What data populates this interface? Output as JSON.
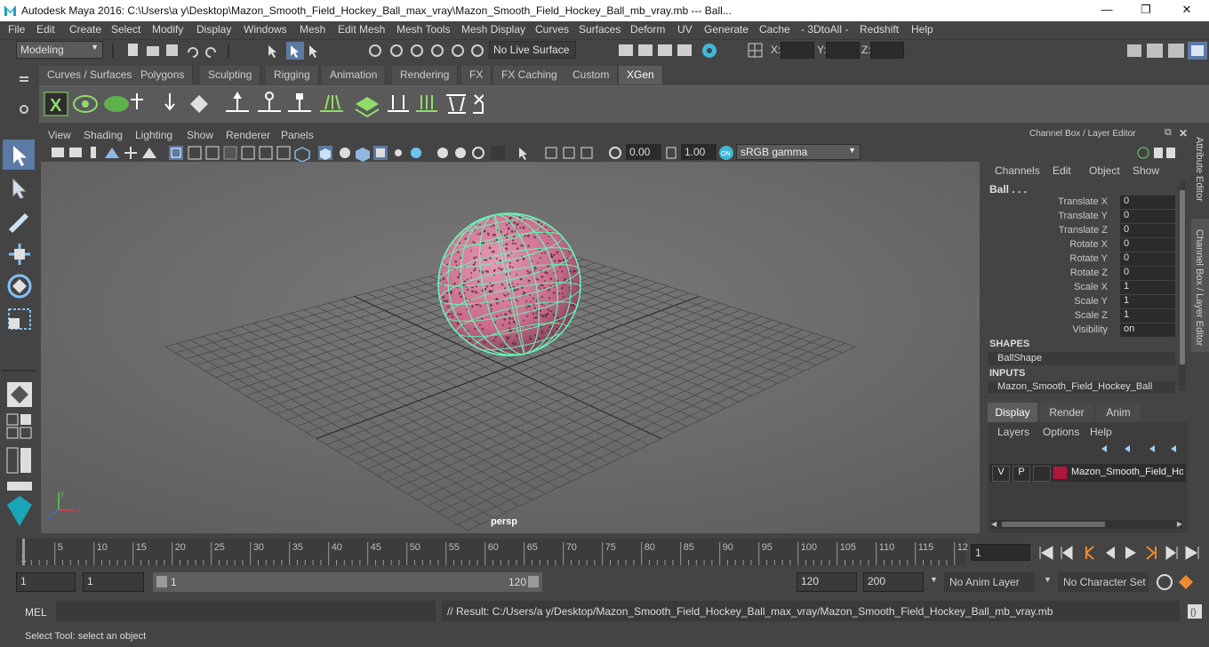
{
  "window": {
    "title": "Autodesk Maya 2016: C:\\Users\\a y\\Desktop\\Mazon_Smooth_Field_Hockey_Ball_max_vray\\Mazon_Smooth_Field_Hockey_Ball_mb_vray.mb   ---   Ball...",
    "minimize": "—",
    "maximize": "❐",
    "close": "✕"
  },
  "menu": [
    "File",
    "Edit",
    "Create",
    "Select",
    "Modify",
    "Display",
    "Windows",
    "Mesh",
    "Edit Mesh",
    "Mesh Tools",
    "Mesh Display",
    "Curves",
    "Surfaces",
    "Deform",
    "UV",
    "Generate",
    "Cache",
    "- 3DtoAll -",
    "Redshift",
    "Help"
  ],
  "status": {
    "mode": "Modeling",
    "live_surface": "No Live Surface",
    "x_label": "X:",
    "y_label": "Y:",
    "z_label": "Z:"
  },
  "shelf_tabs": [
    "Curves / Surfaces",
    "Polygons",
    "Sculpting",
    "Rigging",
    "Animation",
    "Rendering",
    "FX",
    "FX Caching",
    "Custom",
    "XGen"
  ],
  "shelf_active": "XGen",
  "viewport": {
    "menus": [
      "View",
      "Shading",
      "Lighting",
      "Show",
      "Renderer",
      "Panels"
    ],
    "exposure": "0.00",
    "gamma": "1.00",
    "colorspace": "sRGB gamma",
    "camera_label": "persp",
    "ball_color": "#c86b8c",
    "wire_color": "#5dffb5"
  },
  "channel_box": {
    "title": "Channel Box / Layer Editor",
    "menus": [
      "Channels",
      "Edit",
      "Object",
      "Show"
    ],
    "object": "Ball . . .",
    "channels": [
      {
        "label": "Translate X",
        "value": "0"
      },
      {
        "label": "Translate Y",
        "value": "0"
      },
      {
        "label": "Translate Z",
        "value": "0"
      },
      {
        "label": "Rotate X",
        "value": "0"
      },
      {
        "label": "Rotate Y",
        "value": "0"
      },
      {
        "label": "Rotate Z",
        "value": "0"
      },
      {
        "label": "Scale X",
        "value": "1"
      },
      {
        "label": "Scale Y",
        "value": "1"
      },
      {
        "label": "Scale Z",
        "value": "1"
      },
      {
        "label": "Visibility",
        "value": "on"
      }
    ],
    "shapes_header": "SHAPES",
    "shape": "BallShape",
    "inputs_header": "INPUTS",
    "input": "Mazon_Smooth_Field_Hockey_Ball"
  },
  "side_tabs": {
    "attribute_editor": "Attribute Editor",
    "channel_box": "Channel Box / Layer Editor"
  },
  "layer_editor": {
    "tabs": [
      "Display",
      "Render",
      "Anim"
    ],
    "active_tab": "Display",
    "menus": [
      "Layers",
      "Options",
      "Help"
    ],
    "layer": {
      "v": "V",
      "p": "P",
      "name": "Mazon_Smooth_Field_Hockey_Ball",
      "color": "#b0173c"
    }
  },
  "timeline": {
    "ticks": [
      "1",
      "5",
      "10",
      "15",
      "20",
      "25",
      "30",
      "35",
      "40",
      "45",
      "50",
      "55",
      "60",
      "65",
      "70",
      "75",
      "80",
      "85",
      "90",
      "95",
      "100",
      "105",
      "110",
      "115",
      "12"
    ],
    "current_frame": "1"
  },
  "range": {
    "start": "1",
    "playback_start": "1",
    "slider_start": "1",
    "slider_end": "120",
    "playback_end": "120",
    "end": "200",
    "anim_layer": "No Anim Layer",
    "character_set": "No Character Set"
  },
  "command": {
    "mode": "MEL",
    "result": "// Result: C:/Users/a y/Desktop/Mazon_Smooth_Field_Hockey_Ball_max_vray/Mazon_Smooth_Field_Hockey_Ball_mb_vray.mb"
  },
  "help_line": "Select Tool: select an object"
}
